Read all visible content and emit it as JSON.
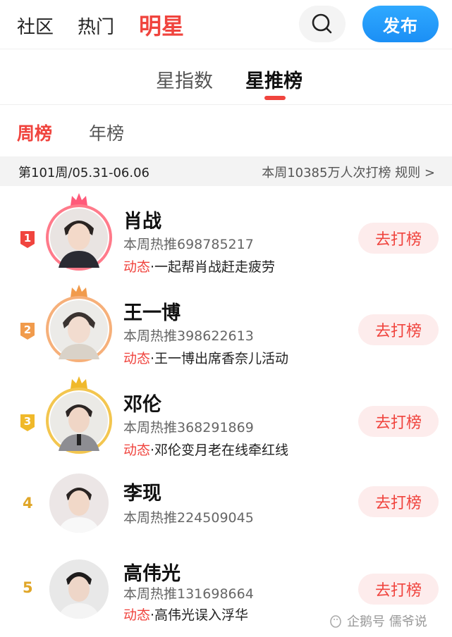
{
  "topnav": {
    "tabs": [
      {
        "label": "社区",
        "active": false
      },
      {
        "label": "热门",
        "active": false
      },
      {
        "label": "明星",
        "active": true
      }
    ],
    "search_icon": "search-icon",
    "publish_label": "发布"
  },
  "subtabs": [
    {
      "label": "星指数",
      "active": false
    },
    {
      "label": "星推榜",
      "active": true
    }
  ],
  "period_tabs": [
    {
      "label": "周榜",
      "active": true
    },
    {
      "label": "年榜",
      "active": false
    }
  ],
  "info": {
    "week": "第101周/05.31-06.06",
    "summary": "本周10385万人次打榜 规则 >"
  },
  "ranking": [
    {
      "rank": "1",
      "name": "肖战",
      "hot": "本周热推698785217",
      "dyn_tag": "动态",
      "dyn_text": "·一起帮肖战赶走疲劳",
      "button": "去打榜"
    },
    {
      "rank": "2",
      "name": "王一博",
      "hot": "本周热推398622613",
      "dyn_tag": "动态",
      "dyn_text": "·王一博出席香奈儿活动",
      "button": "去打榜"
    },
    {
      "rank": "3",
      "name": "邓伦",
      "hot": "本周热推368291869",
      "dyn_tag": "动态",
      "dyn_text": "·邓伦变月老在线牵红线",
      "button": "去打榜"
    },
    {
      "rank": "4",
      "name": "李现",
      "hot": "本周热推224509045",
      "button": "去打榜"
    },
    {
      "rank": "5",
      "name": "高伟光",
      "hot": "本周热推131698664",
      "dyn_tag": "动态",
      "dyn_text": "·高伟光误入浮华",
      "button": "去打榜"
    }
  ],
  "colors": {
    "accent": "#f0443e",
    "gold": "#e0a628",
    "silver_orange": "#f19b4c",
    "publish_blue": "#1b8ff5"
  },
  "watermark": "企鹅号 儒爷说"
}
